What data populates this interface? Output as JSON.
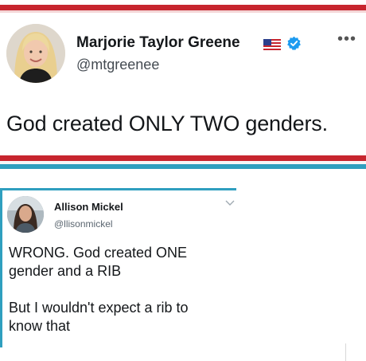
{
  "tweet1": {
    "author_name": "Marjorie Taylor Greene",
    "handle": "@mtgreenee",
    "text": "God created ONLY TWO genders.",
    "more_label": "•••",
    "badges": [
      "us-flag-icon",
      "verified-badge-icon"
    ]
  },
  "tweet2": {
    "author_name": "Allison Mickel",
    "handle": "@llisonmickel",
    "lines": [
      "WRONG. God created ONE",
      "gender and a RIB",
      "But I wouldn't expect a rib to",
      "know that"
    ]
  },
  "colors": {
    "stripe_red": "#c7252e",
    "stripe_blue": "#2f9fbf",
    "verified_blue": "#1d9bf0",
    "text_dark": "#14171a",
    "text_gray": "#5b6670"
  }
}
